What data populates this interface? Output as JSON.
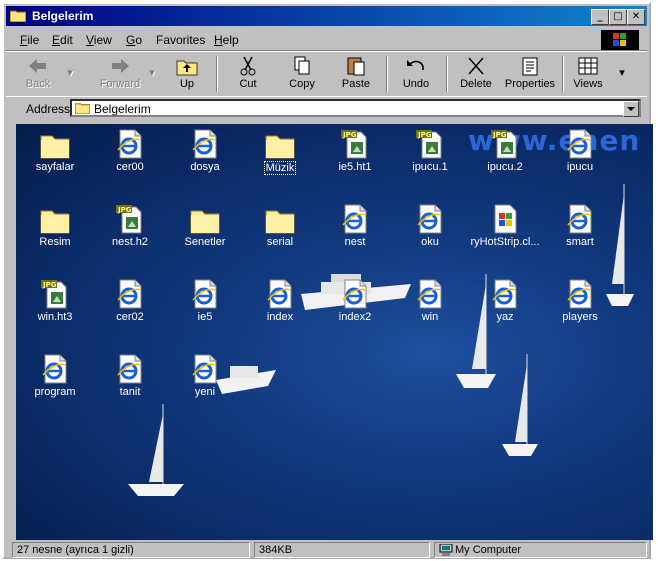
{
  "window": {
    "title": "Belgelerim"
  },
  "menu": {
    "items": [
      {
        "u": "F",
        "rest": "ile"
      },
      {
        "u": "E",
        "rest": "dit"
      },
      {
        "u": "V",
        "rest": "iew"
      },
      {
        "u": "G",
        "rest": "o"
      },
      {
        "u": "",
        "rest": "F",
        "full": "Favorites"
      },
      {
        "u": "H",
        "rest": "elp"
      }
    ]
  },
  "toolbar": {
    "back": "Back",
    "forward": "Forward",
    "up": "Up",
    "cut": "Cut",
    "copy": "Copy",
    "paste": "Paste",
    "undo": "Undo",
    "delete": "Delete",
    "properties": "Properties",
    "views": "Views"
  },
  "address": {
    "label": "Address",
    "value": "Belgelerim"
  },
  "watermark": "www.ehen",
  "icons": [
    {
      "label": "sayfalar",
      "type": "folder"
    },
    {
      "label": "cer00",
      "type": "ie"
    },
    {
      "label": "dosya",
      "type": "ie"
    },
    {
      "label": "Müzik",
      "type": "folder",
      "selected": true
    },
    {
      "label": "ie5.ht1",
      "type": "jpg"
    },
    {
      "label": "ipucu.1",
      "type": "jpg"
    },
    {
      "label": "ipucu.2",
      "type": "jpg"
    },
    {
      "label": "ipucu",
      "type": "ie"
    },
    {
      "label": "Resim",
      "type": "folder"
    },
    {
      "label": "nest.h2",
      "type": "jpg"
    },
    {
      "label": "Senetler",
      "type": "folder"
    },
    {
      "label": "serial",
      "type": "folder"
    },
    {
      "label": "nest",
      "type": "ie"
    },
    {
      "label": "oku",
      "type": "ie"
    },
    {
      "label": "ryHotStrip.cl...",
      "type": "app"
    },
    {
      "label": "smart",
      "type": "ie"
    },
    {
      "label": "win.ht3",
      "type": "jpg"
    },
    {
      "label": "cer02",
      "type": "ie"
    },
    {
      "label": "ie5",
      "type": "ie"
    },
    {
      "label": "index",
      "type": "ie"
    },
    {
      "label": "index2",
      "type": "ie"
    },
    {
      "label": "win",
      "type": "ie"
    },
    {
      "label": "yaz",
      "type": "ie"
    },
    {
      "label": "players",
      "type": "ie"
    },
    {
      "label": "program",
      "type": "ie"
    },
    {
      "label": "tanit",
      "type": "ie"
    },
    {
      "label": "yeni",
      "type": "ie"
    }
  ],
  "status": {
    "objects": "27 nesne (ayrıca 1 gizli)",
    "size": "384KB",
    "location": "My Computer"
  },
  "colors": {
    "titlebar": "#000080",
    "chrome": "#c0c0c0",
    "sea": "#123a80"
  }
}
